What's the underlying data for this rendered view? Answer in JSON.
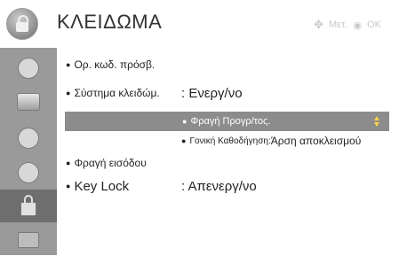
{
  "header": {
    "title": "ΚΛΕΙΔΩΜΑ",
    "hint_move": "Μετ.",
    "hint_ok": "OK",
    "icon": "lock-icon"
  },
  "sidebar": {
    "items": [
      {
        "icon": "picture-icon"
      },
      {
        "icon": "screen-icon"
      },
      {
        "icon": "speaker-icon"
      },
      {
        "icon": "clock-icon"
      },
      {
        "icon": "lock-icon",
        "active": true
      },
      {
        "icon": "option-icon"
      }
    ]
  },
  "menu": {
    "pin_label": "Ορ. κωδ. πρόσβ.",
    "lock_system_label": "Σύστημα κλειδώμ.",
    "lock_system_value": ": Ενεργ/νο",
    "block_program_label": "Φραγή Προγρ/τος.",
    "parental_label": "Γονική Καθοδήγηση:",
    "parental_value": "Άρση αποκλεισμού",
    "input_block_label": "Φραγή εισόδου",
    "key_lock_label": "Key Lock",
    "key_lock_value": ": Απενεργ/νο"
  },
  "colors": {
    "sidebar_bg": "#9a9a9a",
    "highlight_bg": "#8c8c8c",
    "spinner": "#ffd24a"
  }
}
